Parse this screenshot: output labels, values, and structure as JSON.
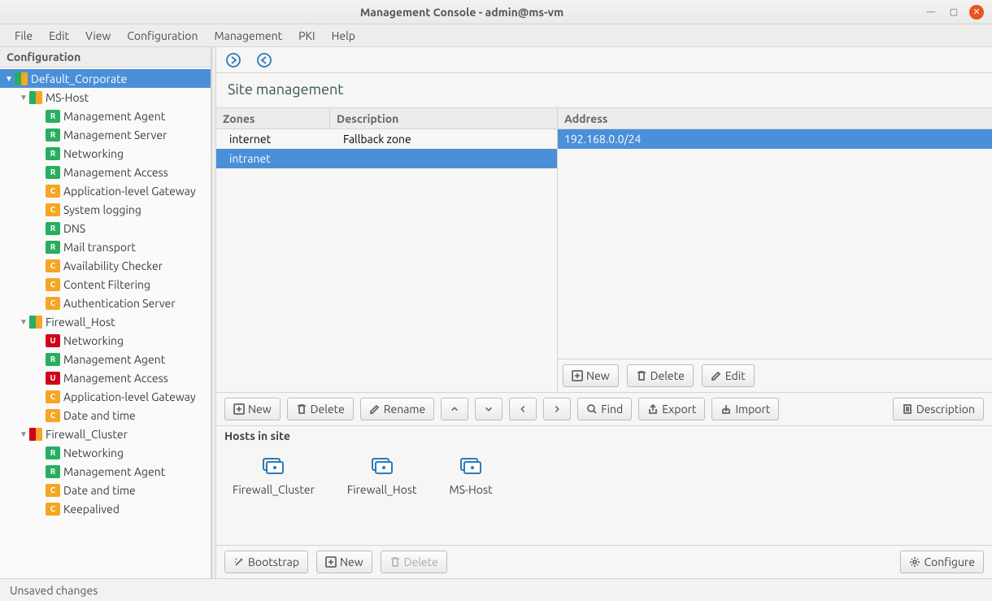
{
  "window": {
    "title": "Management Console - admin@ms-vm"
  },
  "menu": {
    "file": "File",
    "edit": "Edit",
    "view": "View",
    "configuration": "Configuration",
    "management": "Management",
    "pki": "PKI",
    "help": "Help"
  },
  "sidebar": {
    "title": "Configuration",
    "root": "Default_Corporate",
    "root_colors": [
      "#27ae60",
      "#f5a623"
    ],
    "hosts": [
      {
        "name": "MS-Host",
        "colors": [
          "#27ae60",
          "#f5a623"
        ],
        "items": [
          {
            "tag": "R",
            "label": "Management Agent"
          },
          {
            "tag": "R",
            "label": "Management Server"
          },
          {
            "tag": "R",
            "label": "Networking"
          },
          {
            "tag": "R",
            "label": "Management Access"
          },
          {
            "tag": "C",
            "label": "Application-level Gateway"
          },
          {
            "tag": "C",
            "label": "System logging"
          },
          {
            "tag": "R",
            "label": "DNS"
          },
          {
            "tag": "R",
            "label": "Mail transport"
          },
          {
            "tag": "C",
            "label": "Availability Checker"
          },
          {
            "tag": "C",
            "label": "Content Filtering"
          },
          {
            "tag": "C",
            "label": "Authentication Server"
          }
        ]
      },
      {
        "name": "Firewall_Host",
        "colors": [
          "#27ae60",
          "#f5a623"
        ],
        "items": [
          {
            "tag": "U",
            "label": "Networking"
          },
          {
            "tag": "R",
            "label": "Management Agent"
          },
          {
            "tag": "U",
            "label": "Management Access"
          },
          {
            "tag": "C",
            "label": "Application-level Gateway"
          },
          {
            "tag": "C",
            "label": "Date and time"
          }
        ]
      },
      {
        "name": "Firewall_Cluster",
        "colors": [
          "#d0021b",
          "#f5a623"
        ],
        "items": [
          {
            "tag": "R",
            "label": "Networking"
          },
          {
            "tag": "R",
            "label": "Management Agent"
          },
          {
            "tag": "C",
            "label": "Date and time"
          },
          {
            "tag": "C",
            "label": "Keepalived"
          }
        ]
      }
    ]
  },
  "page": {
    "title": "Site management"
  },
  "zones": {
    "headers": {
      "zones": "Zones",
      "description": "Description"
    },
    "rows": [
      {
        "name": "internet",
        "description": "Fallback zone",
        "selected": false
      },
      {
        "name": "intranet",
        "description": "",
        "selected": true
      }
    ]
  },
  "addresses": {
    "header": "Address",
    "rows": [
      {
        "value": "192.168.0.0/24",
        "selected": true
      }
    ]
  },
  "buttons": {
    "new": "New",
    "delete": "Delete",
    "edit": "Edit",
    "rename": "Rename",
    "find": "Find",
    "export": "Export",
    "import": "Import",
    "description": "Description",
    "bootstrap": "Bootstrap",
    "configure": "Configure"
  },
  "hosts_section": {
    "title": "Hosts in site",
    "hosts": [
      "Firewall_Cluster",
      "Firewall_Host",
      "MS-Host"
    ]
  },
  "status": {
    "text": "Unsaved changes"
  }
}
